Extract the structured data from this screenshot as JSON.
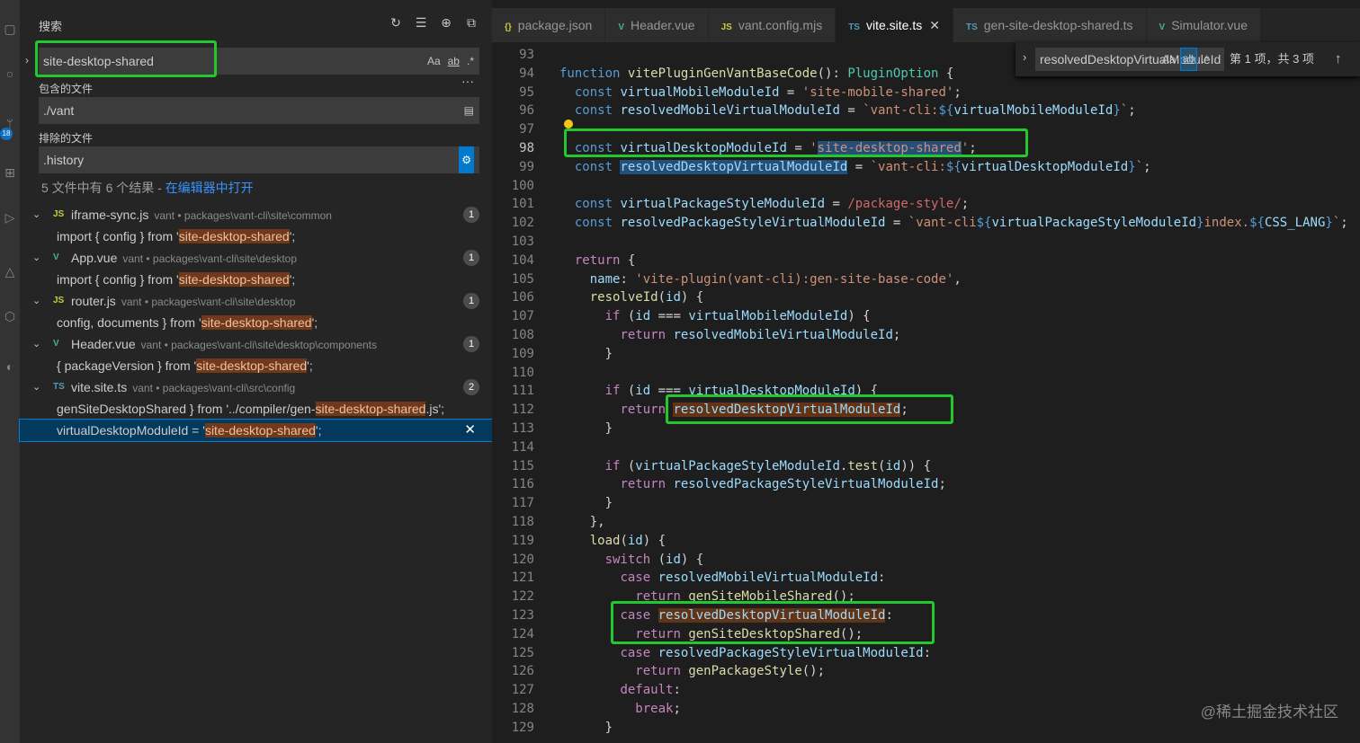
{
  "sidebar": {
    "title": "搜索",
    "search_value": "site-desktop-shared",
    "include_label": "包含的文件",
    "include_value": "./vant",
    "exclude_label": "排除的文件",
    "exclude_value": ".history",
    "summary": "5 文件中有 6 个结果 - ",
    "open_in_editor": "在编辑器中打开",
    "opt_case": "Aa",
    "opt_word": "ab",
    "opt_regex": ".*",
    "results": [
      {
        "icon": "JS",
        "name": "iframe-sync.js",
        "path": "vant • packages\\vant-cli\\site\\common",
        "count": "1",
        "matches": [
          {
            "pre": "import { config } from '",
            "hit": "site-desktop-shared",
            "post": "';"
          }
        ]
      },
      {
        "icon": "V",
        "name": "App.vue",
        "path": "vant • packages\\vant-cli\\site\\desktop",
        "count": "1",
        "matches": [
          {
            "pre": "import { config } from '",
            "hit": "site-desktop-shared",
            "post": "';"
          }
        ]
      },
      {
        "icon": "JS",
        "name": "router.js",
        "path": "vant • packages\\vant-cli\\site\\desktop",
        "count": "1",
        "matches": [
          {
            "pre": "config, documents } from '",
            "hit": "site-desktop-shared",
            "post": "';"
          }
        ]
      },
      {
        "icon": "V",
        "name": "Header.vue",
        "path": "vant • packages\\vant-cli\\site\\desktop\\components",
        "count": "1",
        "matches": [
          {
            "pre": "{ packageVersion } from '",
            "hit": "site-desktop-shared",
            "post": "';"
          }
        ]
      },
      {
        "icon": "TS",
        "name": "vite.site.ts",
        "path": "vant • packages\\vant-cli\\src\\config",
        "count": "2",
        "matches": [
          {
            "pre": "genSiteDesktopShared } from '../compiler/gen-",
            "hit": "site-desktop-shared",
            "post": ".js';"
          },
          {
            "pre": "virtualDesktopModuleId = '",
            "hit": "site-desktop-shared",
            "post": "';"
          }
        ]
      }
    ]
  },
  "tabs": [
    {
      "icon": "{}",
      "label": "package.json"
    },
    {
      "icon": "V",
      "label": "Header.vue"
    },
    {
      "icon": "JS",
      "label": "vant.config.mjs"
    },
    {
      "icon": "TS",
      "label": "vite.site.ts",
      "active": true
    },
    {
      "icon": "TS",
      "label": "gen-site-desktop-shared.ts"
    },
    {
      "icon": "V",
      "label": "Simulator.vue"
    }
  ],
  "find_widget": {
    "value": "resolvedDesktopVirtualModuleId",
    "result": "第 1 项，共 3 项"
  },
  "code_lines": [
    {
      "n": "93",
      "h": ""
    },
    {
      "n": "94",
      "h": "<span class='kw'>function</span> <span class='fn'>vitePluginGenVantBaseCode</span><span class='pu'>(): </span><span class='ty'>PluginOption</span><span class='pu'> {</span>"
    },
    {
      "n": "95",
      "h": "  <span class='kw'>const</span> <span class='vr'>virtualMobileModuleId</span><span class='pu'> = </span><span class='st'>'site-mobile-shared'</span><span class='pu'>;</span>"
    },
    {
      "n": "96",
      "h": "  <span class='kw'>const</span> <span class='vr'>resolvedMobileVirtualModuleId</span><span class='pu'> = </span><span class='st'>`vant-cli:</span><span class='kw'>${</span><span class='vr'>virtualMobileModuleId</span><span class='kw'>}</span><span class='st'>`</span><span class='pu'>;</span>"
    },
    {
      "n": "97",
      "h": ""
    },
    {
      "n": "98",
      "h": "  <span class='kw'>const</span> <span class='vr'>virtualDesktopModuleId</span><span class='pu'> = </span><span class='st'>'<span class=\"sel2\">site-desktop-shared</span>'</span><span class='pu'>;</span>",
      "cur": true
    },
    {
      "n": "99",
      "h": "  <span class='kw'>const</span> <span class='vr sel2'>resolvedDesktopVirtualModuleId</span><span class='pu'> = </span><span class='st'>`vant-cli:</span><span class='kw'>${</span><span class='vr'>virtualDesktopModuleId</span><span class='kw'>}</span><span class='st'>`</span><span class='pu'>;</span>"
    },
    {
      "n": "100",
      "h": ""
    },
    {
      "n": "101",
      "h": "  <span class='kw'>const</span> <span class='vr'>virtualPackageStyleModuleId</span><span class='pu'> = </span><span class='rx'>/package-style/</span><span class='pu'>;</span>"
    },
    {
      "n": "102",
      "h": "  <span class='kw'>const</span> <span class='vr'>resolvedPackageStyleVirtualModuleId</span><span class='pu'> = </span><span class='st'>`vant-cli</span><span class='kw'>${</span><span class='vr'>virtualPackageStyleModuleId</span><span class='kw'>}</span><span class='st'>index.</span><span class='kw'>${</span><span class='vr'>CSS_LANG</span><span class='kw'>}</span><span class='st'>`</span><span class='pu'>;</span>"
    },
    {
      "n": "103",
      "h": ""
    },
    {
      "n": "104",
      "h": "  <span class='ct'>return</span><span class='pu'> {</span>"
    },
    {
      "n": "105",
      "h": "    <span class='vr'>name</span><span class='pu'>: </span><span class='st'>'vite-plugin(vant-cli):gen-site-base-code'</span><span class='pu'>,</span>"
    },
    {
      "n": "106",
      "h": "    <span class='fn'>resolveId</span><span class='pu'>(</span><span class='vr'>id</span><span class='pu'>) {</span>"
    },
    {
      "n": "107",
      "h": "      <span class='ct'>if</span><span class='pu'> (</span><span class='vr'>id</span><span class='pu'> === </span><span class='vr'>virtualMobileModuleId</span><span class='pu'>) {</span>"
    },
    {
      "n": "108",
      "h": "        <span class='ct'>return</span> <span class='vr'>resolvedMobileVirtualModuleId</span><span class='pu'>;</span>"
    },
    {
      "n": "109",
      "h": "      <span class='pu'>}</span>"
    },
    {
      "n": "110",
      "h": ""
    },
    {
      "n": "111",
      "h": "      <span class='ct'>if</span><span class='pu'> (</span><span class='vr'>id</span><span class='pu'> === </span><span class='vr'>virtualDesktopModuleId</span><span class='pu'>) {</span>"
    },
    {
      "n": "112",
      "h": "        <span class='ct'>return</span> <span class='vr findhl'>resolvedDesktopVirtualModuleId</span><span class='pu'>;</span>"
    },
    {
      "n": "113",
      "h": "      <span class='pu'>}</span>"
    },
    {
      "n": "114",
      "h": ""
    },
    {
      "n": "115",
      "h": "      <span class='ct'>if</span><span class='pu'> (</span><span class='vr'>virtualPackageStyleModuleId</span><span class='pu'>.</span><span class='fn'>test</span><span class='pu'>(</span><span class='vr'>id</span><span class='pu'>)) {</span>"
    },
    {
      "n": "116",
      "h": "        <span class='ct'>return</span> <span class='vr'>resolvedPackageStyleVirtualModuleId</span><span class='pu'>;</span>"
    },
    {
      "n": "117",
      "h": "      <span class='pu'>}</span>"
    },
    {
      "n": "118",
      "h": "    <span class='pu'>},</span>"
    },
    {
      "n": "119",
      "h": "    <span class='fn'>load</span><span class='pu'>(</span><span class='vr'>id</span><span class='pu'>) {</span>"
    },
    {
      "n": "120",
      "h": "      <span class='ct'>switch</span><span class='pu'> (</span><span class='vr'>id</span><span class='pu'>) {</span>"
    },
    {
      "n": "121",
      "h": "        <span class='ct'>case</span> <span class='vr'>resolvedMobileVirtualModuleId</span><span class='pu'>:</span>"
    },
    {
      "n": "122",
      "h": "          <span class='ct'>return</span> <span class='fn'>genSiteMobileShared</span><span class='pu'>();</span>"
    },
    {
      "n": "123",
      "h": "        <span class='ct'>case</span> <span class='vr findhl'>resolvedDesktopVirtualModuleId</span><span class='pu'>:</span>"
    },
    {
      "n": "124",
      "h": "          <span class='ct'>return</span> <span class='fn'>genSiteDesktopShared</span><span class='pu'>();</span>"
    },
    {
      "n": "125",
      "h": "        <span class='ct'>case</span> <span class='vr'>resolvedPackageStyleVirtualModuleId</span><span class='pu'>:</span>"
    },
    {
      "n": "126",
      "h": "          <span class='ct'>return</span> <span class='fn'>genPackageStyle</span><span class='pu'>();</span>"
    },
    {
      "n": "127",
      "h": "        <span class='ct'>default</span><span class='pu'>:</span>"
    },
    {
      "n": "128",
      "h": "          <span class='ct'>break</span><span class='pu'>;</span>"
    },
    {
      "n": "129",
      "h": "      <span class='pu'>}</span>"
    }
  ],
  "watermark": "@稀土掘金技术社区",
  "colors": {
    "accent": "#007acc",
    "highlight_box": "#22c82d",
    "match_bg": "#703a1a"
  }
}
